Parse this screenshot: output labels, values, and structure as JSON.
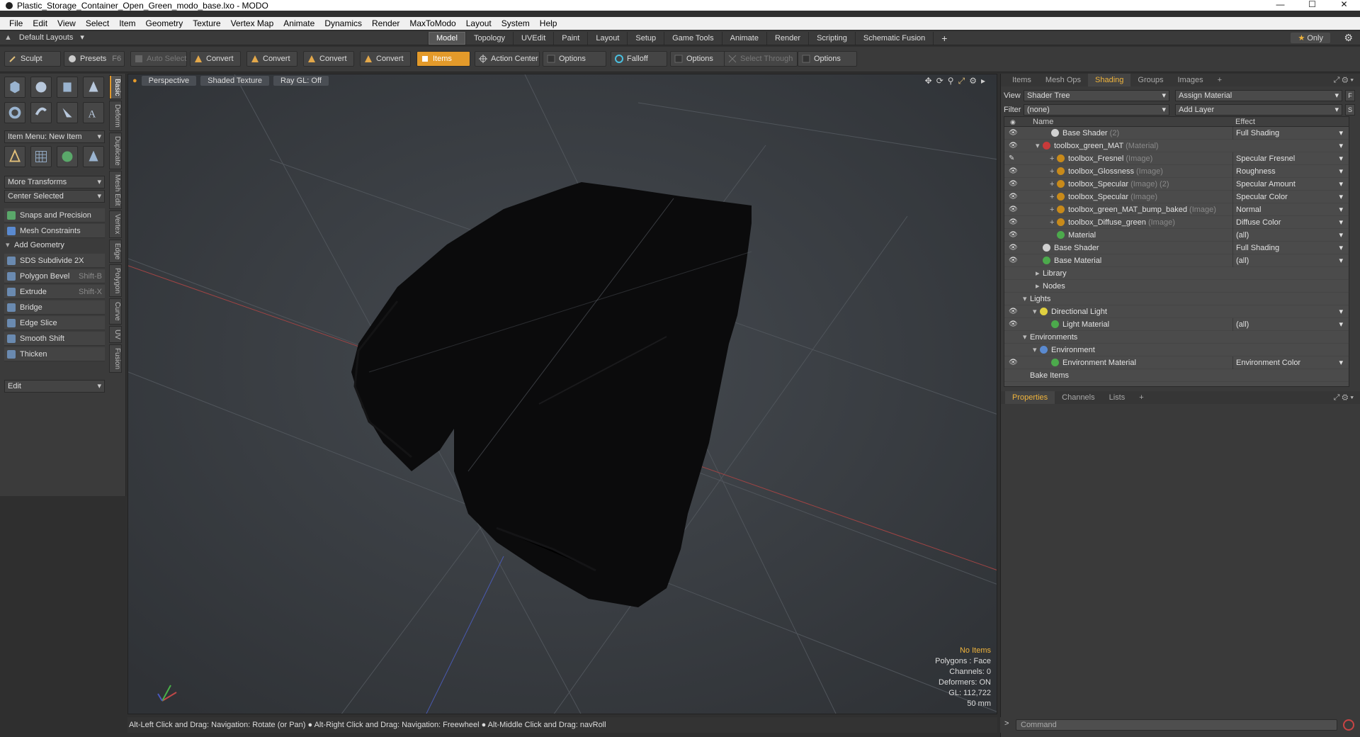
{
  "window": {
    "title": "Plastic_Storage_Container_Open_Green_modo_base.lxo - MODO",
    "controls": [
      "—",
      "☐",
      "✕"
    ]
  },
  "menu": [
    "File",
    "Edit",
    "View",
    "Select",
    "Item",
    "Geometry",
    "Texture",
    "Vertex Map",
    "Animate",
    "Dynamics",
    "Render",
    "MaxToModo",
    "Layout",
    "System",
    "Help"
  ],
  "layoutbar": {
    "layout_name": "Default Layouts",
    "tabs": [
      "Model",
      "Topology",
      "UVEdit",
      "Paint",
      "Layout",
      "Setup",
      "Game Tools",
      "Animate",
      "Render",
      "Scripting",
      "Schematic Fusion"
    ],
    "active_tab": "Model",
    "plus": "+",
    "only_label": "Only"
  },
  "toolbar": {
    "sculpt": "Sculpt",
    "presets": "Presets",
    "presets_key": "F6",
    "auto_select": "Auto Select",
    "convert1": "Convert",
    "convert2": "Convert",
    "convert3": "Convert",
    "convert4": "Convert",
    "items": "Items",
    "action_center": "Action Center",
    "options1": "Options",
    "falloff": "Falloff",
    "options2": "Options",
    "select_through": "Select Through",
    "options3": "Options"
  },
  "lefttools": {
    "item_menu": "Item Menu: New Item",
    "more_transforms": "More Transforms",
    "center_selected": "Center Selected",
    "snaps": "Snaps and Precision",
    "mesh_constraints": "Mesh Constraints",
    "add_geometry": "Add Geometry",
    "tools": [
      {
        "label": "SDS Subdivide 2X",
        "key": ""
      },
      {
        "label": "Polygon Bevel",
        "key": "Shift-B"
      },
      {
        "label": "Extrude",
        "key": "Shift-X"
      },
      {
        "label": "Bridge",
        "key": ""
      },
      {
        "label": "Edge Slice",
        "key": ""
      },
      {
        "label": "Smooth Shift",
        "key": ""
      },
      {
        "label": "Thicken",
        "key": ""
      }
    ],
    "edit": "Edit",
    "vtabs": [
      "Basic",
      "Deform",
      "Duplicate",
      "Mesh Edit",
      "Vertex",
      "Edge",
      "Polygon",
      "Curve",
      "UV",
      "Fusion"
    ]
  },
  "viewport": {
    "perspective": "Perspective",
    "shading": "Shaded Texture",
    "raygl": "Ray GL: Off",
    "info": {
      "no_items": "No Items",
      "polygons": "Polygons : Face",
      "channels": "Channels: 0",
      "deformers": "Deformers: ON",
      "gl": "GL: 112,722",
      "scale": "50 mm"
    }
  },
  "statusbar": "Alt-Left Click and Drag: Navigation: Rotate (or Pan) ●  Alt-Right Click and Drag: Navigation: Freewheel ●  Alt-Middle Click and Drag: navRoll",
  "shading_panel": {
    "tabs": [
      "Items",
      "Mesh Ops",
      "Shading",
      "Groups",
      "Images"
    ],
    "active_tab": "Shading",
    "view_label": "View",
    "view_value": "Shader Tree",
    "assign_material": "Assign Material",
    "filter_label": "Filter",
    "filter_value": "(none)",
    "add_layer": "Add Layer",
    "f_btn": "F",
    "s_btn": "S",
    "col_name": "Name",
    "col_effect": "Effect",
    "rows": [
      {
        "name": "Base Shader",
        "type": "(2)",
        "effect": "Full Shading",
        "eye": "👁",
        "indent": 56,
        "ball": "#d0d0d0",
        "exp": ""
      },
      {
        "name": "toolbox_green_MAT",
        "type": "(Material)",
        "effect": "",
        "eye": "👁",
        "indent": 44,
        "ball": "#c83a3a",
        "exp": "▾"
      },
      {
        "name": "toolbox_Fresnel",
        "type": "(Image)",
        "effect": "Specular Fresnel",
        "eye": "✎",
        "indent": 64,
        "ball": "#c88a1a",
        "exp": "+"
      },
      {
        "name": "toolbox_Glossness",
        "type": "(Image)",
        "effect": "Roughness",
        "eye": "👁",
        "indent": 64,
        "ball": "#c88a1a",
        "exp": "+"
      },
      {
        "name": "toolbox_Specular",
        "type": "(Image) (2)",
        "effect": "Specular Amount",
        "eye": "👁",
        "indent": 64,
        "ball": "#c88a1a",
        "exp": "+"
      },
      {
        "name": "toolbox_Specular",
        "type": "(Image)",
        "effect": "Specular Color",
        "eye": "👁",
        "indent": 64,
        "ball": "#c88a1a",
        "exp": "+"
      },
      {
        "name": "toolbox_green_MAT_bump_baked",
        "type": "(Image)",
        "effect": "Normal",
        "eye": "👁",
        "indent": 64,
        "ball": "#c88a1a",
        "exp": "+"
      },
      {
        "name": "toolbox_Diffuse_green",
        "type": "(Image)",
        "effect": "Diffuse Color",
        "eye": "👁",
        "indent": 64,
        "ball": "#c88a1a",
        "exp": "+"
      },
      {
        "name": "Material",
        "type": "",
        "effect": "(all)",
        "eye": "👁",
        "indent": 64,
        "ball": "#4caa4c",
        "exp": ""
      },
      {
        "name": "Base Shader",
        "type": "",
        "effect": "Full Shading",
        "eye": "👁",
        "indent": 44,
        "ball": "#d0d0d0",
        "exp": ""
      },
      {
        "name": "Base Material",
        "type": "",
        "effect": "(all)",
        "eye": "👁",
        "indent": 44,
        "ball": "#4caa4c",
        "exp": ""
      },
      {
        "name": "Library",
        "type": "",
        "effect": "",
        "eye": "",
        "indent": 44,
        "ball": "",
        "exp": "▸"
      },
      {
        "name": "Nodes",
        "type": "",
        "effect": "",
        "eye": "",
        "indent": 44,
        "ball": "",
        "exp": "▸"
      },
      {
        "name": "Lights",
        "type": "",
        "effect": "",
        "eye": "",
        "indent": 26,
        "ball": "",
        "exp": "▾"
      },
      {
        "name": "Directional Light",
        "type": "",
        "effect": "",
        "eye": "👁",
        "indent": 40,
        "ball": "#e0d040",
        "exp": "▾"
      },
      {
        "name": "Light Material",
        "type": "",
        "effect": "(all)",
        "eye": "👁",
        "indent": 56,
        "ball": "#4caa4c",
        "exp": ""
      },
      {
        "name": "Environments",
        "type": "",
        "effect": "",
        "eye": "",
        "indent": 26,
        "ball": "",
        "exp": "▾"
      },
      {
        "name": "Environment",
        "type": "",
        "effect": "",
        "eye": "",
        "indent": 40,
        "ball": "#5a8ad0",
        "exp": "▾"
      },
      {
        "name": "Environment Material",
        "type": "",
        "effect": "Environment Color",
        "eye": "👁",
        "indent": 56,
        "ball": "#4caa4c",
        "exp": ""
      },
      {
        "name": "Bake Items",
        "type": "",
        "effect": "",
        "eye": "",
        "indent": 26,
        "ball": "",
        "exp": ""
      }
    ]
  },
  "properties_panel": {
    "tabs": [
      "Properties",
      "Channels",
      "Lists"
    ],
    "active_tab": "Properties",
    "plus": "+"
  },
  "command": {
    "prompt": ">",
    "placeholder": "Command"
  }
}
